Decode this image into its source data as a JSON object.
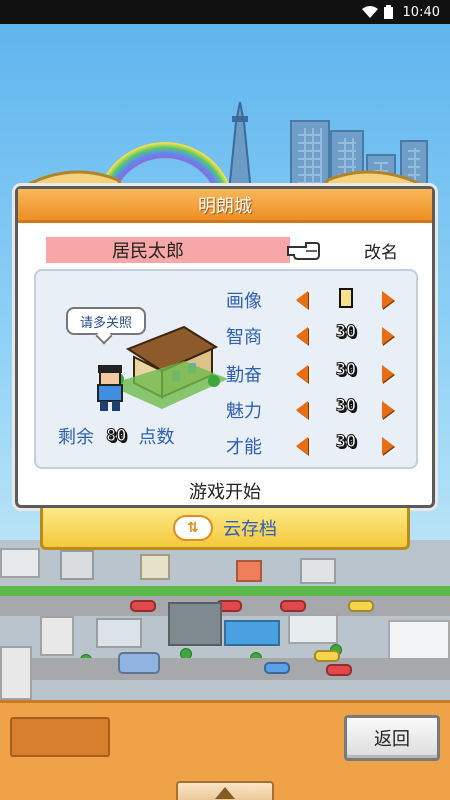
{
  "status_bar": {
    "time": "10:40"
  },
  "dialog": {
    "title": "明朗城",
    "resident_name": "居民太郎",
    "rename_label": "改名",
    "speech_bubble": "请多关照",
    "stats": [
      {
        "label": "画像",
        "value": "1"
      },
      {
        "label": "智商",
        "value": "30"
      },
      {
        "label": "勤奋",
        "value": "30"
      },
      {
        "label": "魅力",
        "value": "30"
      },
      {
        "label": "才能",
        "value": "30"
      }
    ],
    "remaining": {
      "prefix": "剩余",
      "value": "80",
      "suffix": "点数"
    },
    "start_label": "游戏开始"
  },
  "cloud_save": {
    "label": "云存档"
  },
  "bottom_bar": {
    "back_label": "返回"
  },
  "colors": {
    "header_orange": "#ee8f25",
    "stat_blue": "#2d5fb4",
    "arrow_orange": "#e96d12"
  }
}
